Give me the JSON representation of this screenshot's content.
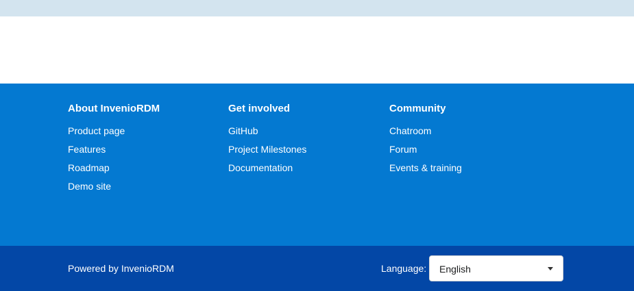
{
  "colors": {
    "top_strip": "#d3e4ef",
    "footer_main_bg": "#0479d1",
    "footer_bottom_bg": "#0347a6",
    "text": "#ffffff"
  },
  "footer": {
    "columns": [
      {
        "heading": "About InvenioRDM",
        "links": [
          "Product page",
          "Features",
          "Roadmap",
          "Demo site"
        ]
      },
      {
        "heading": "Get involved",
        "links": [
          "GitHub",
          "Project Milestones",
          "Documentation"
        ]
      },
      {
        "heading": "Community",
        "links": [
          "Chatroom",
          "Forum",
          "Events & training"
        ]
      }
    ]
  },
  "bottom_bar": {
    "powered_prefix": "Powered by",
    "powered_link": "InvenioRDM",
    "language_label": "Language:",
    "language_selected": "English",
    "language_icon": "caret-down-icon"
  }
}
